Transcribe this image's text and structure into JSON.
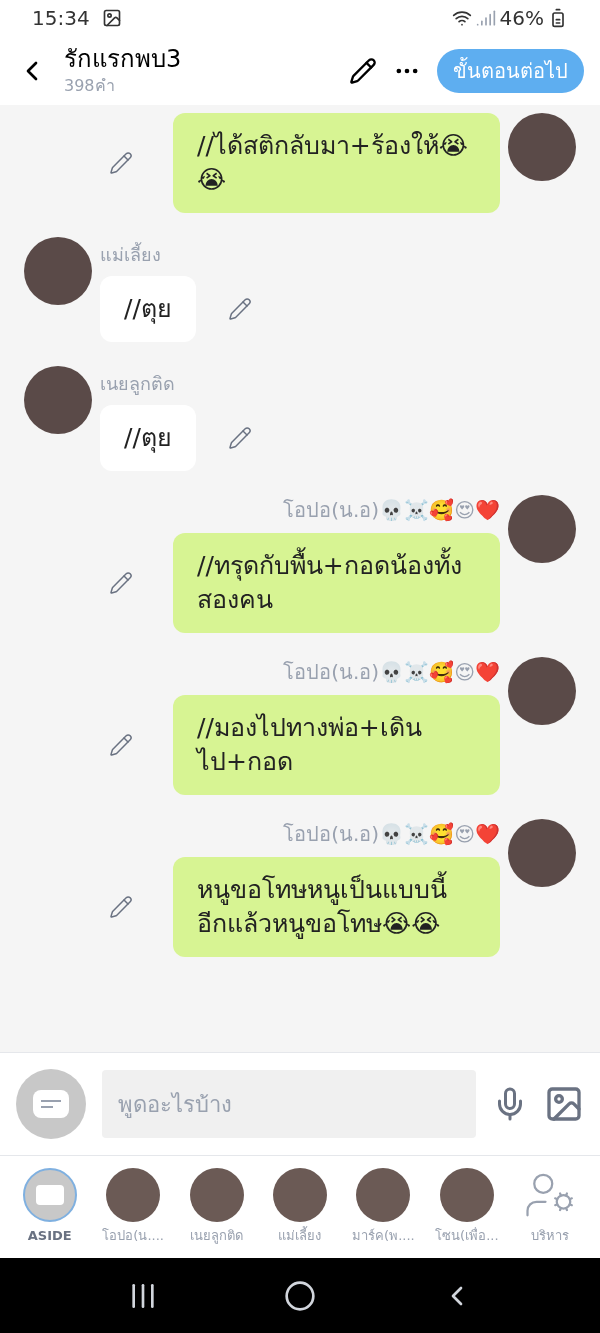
{
  "status_bar": {
    "time": "15:34",
    "battery": "46%"
  },
  "header": {
    "title": "รักแรกพบ3",
    "subtitle": "398คำ",
    "next_button": "ขั้นตอนต่อไป"
  },
  "messages": [
    {
      "kind": "right",
      "text": "//ได้สติกลับมา+ร้องให้😭😭"
    },
    {
      "kind": "left",
      "sender": "แม่เลี้ยง",
      "text": "//ตุย"
    },
    {
      "kind": "left",
      "sender": "เนยลูกติด",
      "text": "//ตุย"
    },
    {
      "kind": "right",
      "sender": "โอปอ(น.อ)💀☠️🥰😍❤️",
      "text": "//ทรุดกับพื้น+กอดน้องทั้งสองคน"
    },
    {
      "kind": "right",
      "sender": "โอปอ(น.อ)💀☠️🥰😍❤️",
      "text": "//มองไปทางพ่อ+เดินไป+กอด"
    },
    {
      "kind": "right",
      "sender": "โอปอ(น.อ)💀☠️🥰😍❤️",
      "text": "หนูขอโทษหนูเป็นแบบนี้อีกแล้วหนูขอโทษ😭😭"
    }
  ],
  "input": {
    "placeholder": "พูดอะไรบ้าง"
  },
  "characters": [
    {
      "kind": "aside",
      "label": "ASIDE",
      "selected": true
    },
    {
      "kind": "avatar",
      "label": "โอปอ(น....",
      "selected": false
    },
    {
      "kind": "avatar",
      "label": "เนยลูกติด",
      "selected": false
    },
    {
      "kind": "avatar",
      "label": "แม่เลี้ยง",
      "selected": false
    },
    {
      "kind": "avatar",
      "label": "มาร์ค(พ....",
      "selected": false
    },
    {
      "kind": "avatar",
      "label": "โซน(เพื่อ...",
      "selected": false
    },
    {
      "kind": "manage",
      "label": "บริหาร",
      "selected": false
    }
  ]
}
